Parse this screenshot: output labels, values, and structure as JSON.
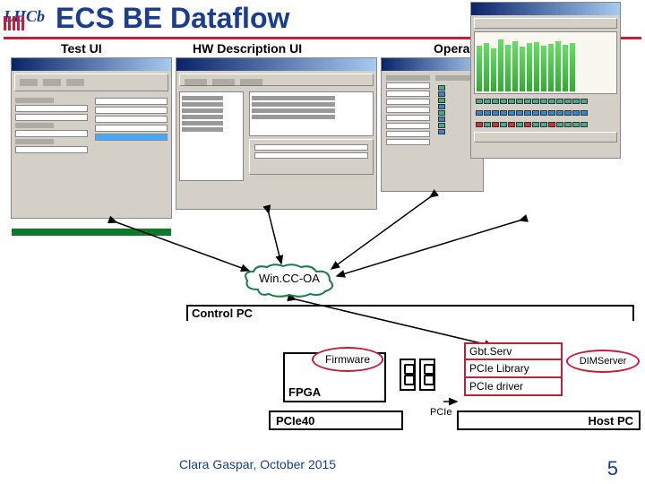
{
  "header": {
    "logo_text": "LHCb",
    "title": "ECS BE Dataflow"
  },
  "ui_labels": {
    "test": "Test UI",
    "hw": "HW Description UI",
    "operation": "Operation UI"
  },
  "cloud": {
    "label": "Win.CC-OA"
  },
  "control_pc": {
    "label": "Control PC"
  },
  "fpga": {
    "label": "FPGA",
    "firmware": "Firmware"
  },
  "pcie40": {
    "label": "PCIe40"
  },
  "stack": {
    "gbtserv": "Gbt.Serv",
    "pcie_lib": "PCIe Library",
    "pcie_drv": "PCIe driver"
  },
  "dimserver": {
    "label": "DIMServer"
  },
  "hostpc": {
    "label": "Host PC"
  },
  "pcie": {
    "label": "PCIe"
  },
  "footer": {
    "author": "Clara Gaspar, October 2015",
    "page": "5"
  }
}
